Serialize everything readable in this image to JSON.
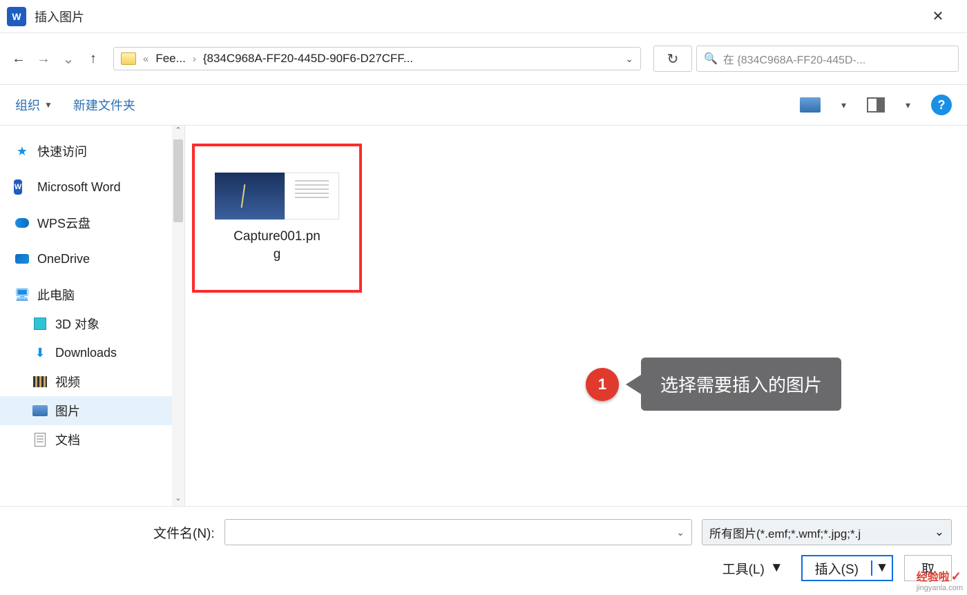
{
  "title": "插入图片",
  "breadcrumb": {
    "prefix": "«",
    "seg1": "Fee...",
    "seg2": "{834C968A-FF20-445D-90F6-D27CFF..."
  },
  "search_placeholder": "在 {834C968A-FF20-445D-...",
  "toolbar": {
    "organize": "组织",
    "newfolder": "新建文件夹"
  },
  "sidebar": {
    "quick": "快速访问",
    "word": "Microsoft Word",
    "wps": "WPS云盘",
    "onedrive": "OneDrive",
    "thispc": "此电脑",
    "obj3d": "3D 对象",
    "downloads": "Downloads",
    "video": "视频",
    "pictures": "图片",
    "docs": "文档"
  },
  "file": {
    "name_line1": "Capture001.pn",
    "name_line2": "g"
  },
  "callout": {
    "badge": "1",
    "text": "选择需要插入的图片"
  },
  "footer": {
    "fn_label": "文件名(N):",
    "filter": "所有图片(*.emf;*.wmf;*.jpg;*.j",
    "tools": "工具(L)",
    "insert": "插入(S)",
    "cancel": "取"
  },
  "watermark": {
    "l1": "经验啦",
    "l2": "jingyanla.com"
  }
}
